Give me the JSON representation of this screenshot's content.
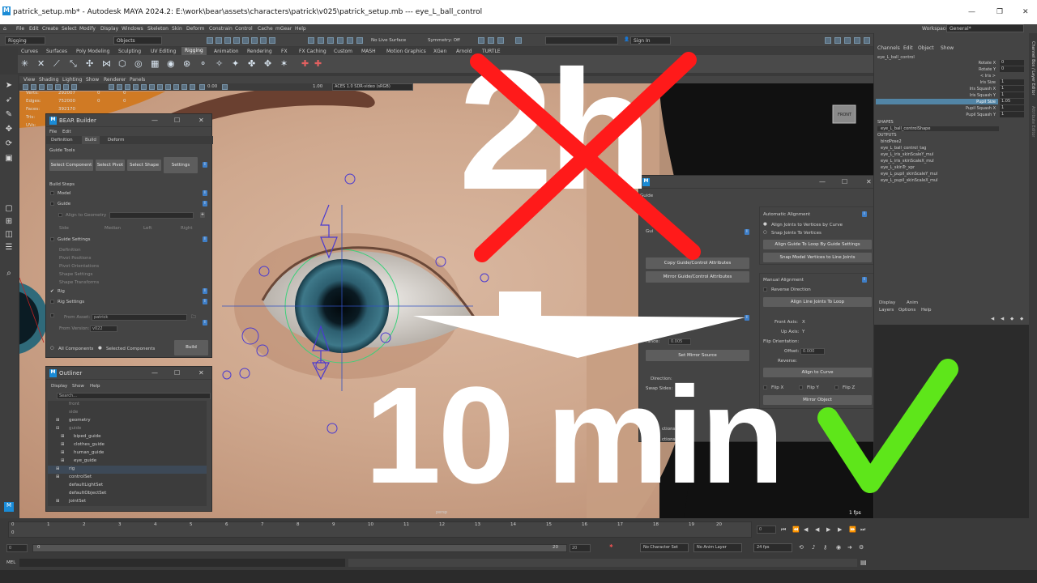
{
  "window": {
    "title": "patrick_setup.mb* - Autodesk MAYA 2024.2: E:\\work\\bear\\assets\\characters\\patrick\\v025\\patrick_setup.mb  ---  eye_L_ball_control"
  },
  "menubar": [
    "File",
    "Edit",
    "Create",
    "Select",
    "Modify",
    "Display",
    "Windows",
    "Skeleton",
    "Skin",
    "Deform",
    "Constrain",
    "Control",
    "Cache",
    "mGear",
    "Help"
  ],
  "workspace": {
    "label": "Workspace:",
    "value": "General*"
  },
  "statusline": {
    "menuset": "Rigging",
    "objects": "Objects",
    "live_surface": "No Live Surface",
    "symmetry": "Symmetry: Off",
    "sign_in": "Sign In"
  },
  "shelf_tabs": [
    "Curves",
    "Surfaces",
    "Poly Modeling",
    "Sculpting",
    "UV Editing",
    "Rigging",
    "Animation",
    "Rendering",
    "FX",
    "FX Caching",
    "Custom",
    "MASH",
    "Motion Graphics",
    "XGen",
    "Arnold",
    "TURTLE"
  ],
  "shelf_active": "Rigging",
  "viewport": {
    "menu": [
      "View",
      "Shading",
      "Lighting",
      "Show",
      "Renderer",
      "Panels"
    ],
    "hud_labels": [
      "Verts:",
      "Edges:",
      "Faces:",
      "Tris:",
      "UVs:"
    ],
    "hud_values": [
      "292007",
      "752000",
      "392170",
      "",
      ""
    ],
    "hud_zero": "0",
    "value_a": "0.00",
    "value_b": "1.00",
    "color_space": "ACES 1.0 SDR-video (sRGB)",
    "camera": "persp",
    "fps": "1 fps",
    "cube_label": "FRONT"
  },
  "bear_builder": {
    "title": "BEAR Builder",
    "menu": [
      "File",
      "Edit"
    ],
    "tabs": [
      "Definition",
      "Build",
      "Deform"
    ],
    "guide_tools": "Guide Tools",
    "buttons": [
      "Select Component",
      "Select Pivot",
      "Select Shape",
      "Settings"
    ],
    "build_steps": "Build Steps",
    "model": "Model",
    "guide": "Guide",
    "align_to_geometry": "Align to Geometry",
    "side_labels": [
      "Side",
      "Median",
      "Left",
      "Right"
    ],
    "guide_settings": "Guide Settings",
    "guide_sub": [
      "Definition",
      "Pivot Positions",
      "Pivot Orientations",
      "Shape Settings",
      "Shape Transforms"
    ],
    "rig": "Rig",
    "rig_settings": "Rig Settings",
    "from_asset": "From Asset:",
    "from_asset_value": "patrick",
    "from_version": "From Version:",
    "from_version_value": "v022",
    "all_components": "All Components",
    "selected_components": "Selected Components",
    "build": "Build"
  },
  "outliner": {
    "title": "Outliner",
    "menu": [
      "Display",
      "Show",
      "Help"
    ],
    "search": "Search...",
    "items": [
      "front",
      "side",
      "geometry",
      "guide",
      "biped_guide",
      "clothes_guide",
      "human_guide",
      "eye_guide",
      "rig",
      "controlSet",
      "defaultLightSet",
      "defaultObjectSet",
      "jointSet"
    ]
  },
  "guide_panel": {
    "title_fragment": "Guide",
    "left_fragment": "Gui",
    "copy": "Copy Guide/Control Attributes",
    "mirror": "Mirror Guide/Control Attributes",
    "tolerance": "rance:",
    "tolerance_value": "0.005",
    "set_mirror_source": "Set Mirror Source",
    "direction": "Direction:",
    "swap_sides": "Swap Sides:",
    "frag_a": "ctions",
    "frag_b": "ctions",
    "automatic_alignment": "Automatic Alignment",
    "align_by_curve": "Align Joints to Vertices by Curve",
    "snap_to_vertices": "Snap Joints To Vertices",
    "align_loop": "Align Guide To Loop By Guide Settings",
    "snap_model": "Snap Model Vertices to Line Joints",
    "manual_alignment": "Manual Alignment",
    "reverse_direction": "Reverse Direction",
    "align_line": "Align Line Joints To Loop",
    "front_axis": "Front Axis:",
    "front_axis_value": "X",
    "up_axis": "Up Axis:",
    "up_axis_value": "Y",
    "flip_orientation": "Flip Orientation:",
    "offset": "Offset:",
    "offset_value": "0.000",
    "reverse": "Reverse:",
    "align_curve": "Align to Curve",
    "flips": [
      "Flip X",
      "Flip Y",
      "Flip Z"
    ],
    "mirror_object": "Mirror Object"
  },
  "channel_box": {
    "menu": [
      "Channels",
      "Edit",
      "Object",
      "Show"
    ],
    "object": "eye_L_ball_control",
    "attrs": [
      {
        "name": "Rotate X",
        "value": "0"
      },
      {
        "name": "Rotate Y",
        "value": "0"
      },
      {
        "name": "< Iris >",
        "value": ""
      },
      {
        "name": "Iris Size",
        "value": "1"
      },
      {
        "name": "Iris Squash X",
        "value": "1"
      },
      {
        "name": "Iris Squash Y",
        "value": "1"
      },
      {
        "name": "Pupil Size",
        "value": "1.05"
      },
      {
        "name": "Pupil Squash X",
        "value": "1"
      },
      {
        "name": "Pupil Squash Y",
        "value": "1"
      }
    ],
    "shapes_header": "SHAPES",
    "shape": "eye_L_ball_controlShape",
    "outputs_header": "OUTPUTS",
    "outputs": [
      "bindPose2",
      "eye_L_ball_control_tag",
      "eye_L_iris_skinScaleY_mul",
      "eye_L_iris_skinScaleX_mul",
      "eye_L_skinTr_xpr",
      "eye_L_pupil_skinScaleY_mul",
      "eye_L_pupil_skinScaleX_mul"
    ]
  },
  "layer_editor": {
    "tabs": [
      "Display",
      "Anim"
    ],
    "menu": [
      "Layers",
      "Options",
      "Help"
    ]
  },
  "side_tabs": "Channel Box / Layer Editor",
  "side_tabs_b": "Attribute Editor",
  "timeline": {
    "ticks": [
      "0",
      "1",
      "2",
      "3",
      "4",
      "5",
      "6",
      "7",
      "8",
      "9",
      "10",
      "11",
      "12",
      "13",
      "14",
      "15",
      "16",
      "17",
      "18",
      "19",
      "20"
    ],
    "current": "0",
    "range_start": "0",
    "range_inner": "0",
    "range_end_a": "20",
    "range_end_b": "20",
    "character_set": "No Character Set",
    "anim_layer": "No Anim Layer",
    "fps": "24 fps"
  },
  "cmdline": {
    "label": "MEL"
  },
  "overlay": {
    "before": "2h",
    "after": "10 min"
  },
  "colors": {
    "red_cross": "#ff1a1a",
    "green_check": "#5ee61a",
    "maya_blue": "#1a8bd6",
    "highlight": "#5285a6"
  }
}
